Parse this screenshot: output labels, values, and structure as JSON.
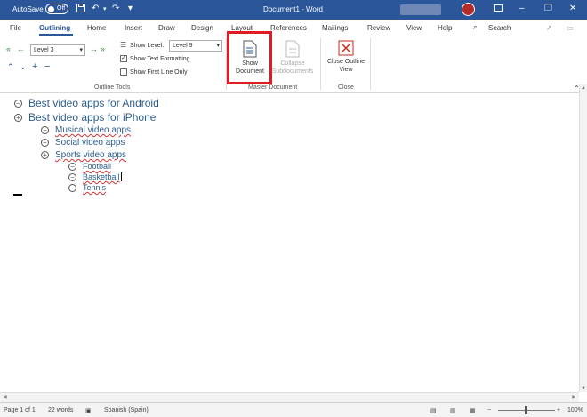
{
  "titlebar": {
    "autosave_label": "AutoSave",
    "autosave_state": "Off",
    "document_title": "Document1 - Word",
    "color": "#2b579a"
  },
  "tabs": [
    "File",
    "Outlining",
    "Home",
    "Insert",
    "Draw",
    "Design",
    "Layout",
    "References",
    "Mailings",
    "Review",
    "View",
    "Help"
  ],
  "active_tab": "Outlining",
  "search_label": "Search",
  "ribbon": {
    "outline_level_value": "Level 3",
    "show_level_label": "Show Level:",
    "show_level_value": "Level 9",
    "show_text_formatting_label": "Show Text Formatting",
    "show_text_formatting_checked": true,
    "show_first_line_only_label": "Show First Line Only",
    "show_first_line_only_checked": false,
    "outline_tools_group": "Outline Tools",
    "show_document_label": "Show Document",
    "collapse_subdocuments_label": "Collapse Subdocuments",
    "master_document_group": "Master Document",
    "close_outline_view_label": "Close Outline View",
    "close_group": "Close"
  },
  "outline": [
    {
      "text": "Best video apps for Android",
      "level": 1,
      "symbol": "minus"
    },
    {
      "text": "Best video apps for iPhone",
      "level": 1,
      "symbol": "plus"
    },
    {
      "text": "Musical video apps",
      "level": 2,
      "symbol": "minus"
    },
    {
      "text": "Social video apps",
      "level": 2,
      "symbol": "minus"
    },
    {
      "text": "Sports video apps",
      "level": 2,
      "symbol": "plus"
    },
    {
      "text": "Football",
      "level": 3,
      "symbol": "minus"
    },
    {
      "text": "Basketball",
      "level": 3,
      "symbol": "minus"
    },
    {
      "text": "Tennis",
      "level": 3,
      "symbol": "minus"
    }
  ],
  "status": {
    "page": "Page 1 of 1",
    "words": "22 words",
    "language": "Spanish (Spain)",
    "zoom": "100%"
  }
}
